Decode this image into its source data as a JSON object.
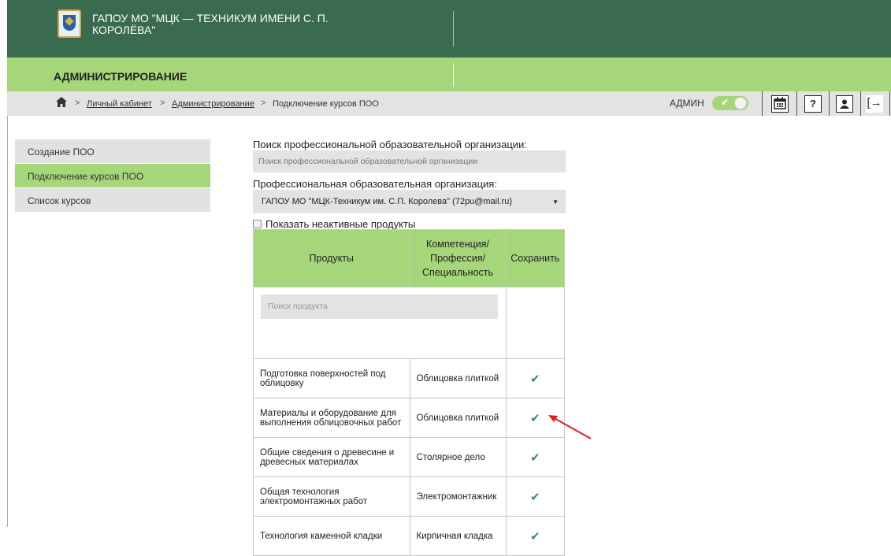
{
  "header": {
    "org_title": "ГАПОУ МО \"МЦК — ТЕХНИКУМ ИМЕНИ С. П. КОРОЛЁВА\"",
    "section_title": "АДМИНИСТРИРОВАНИЕ"
  },
  "breadcrumb": {
    "items": [
      "Личный кабинет",
      "Администрирование",
      "Подключение курсов ПОО"
    ],
    "separator": ">"
  },
  "toolbar": {
    "role_label": "АДМИН",
    "help_label": "?",
    "logout_label": "[→"
  },
  "sidebar": {
    "items": [
      {
        "label": "Создание ПОО",
        "active": false
      },
      {
        "label": "Подключение курсов ПОО",
        "active": true
      },
      {
        "label": "Список курсов",
        "active": false
      }
    ]
  },
  "main": {
    "search_label": "Поиск профессиональной образовательной организации:",
    "search_placeholder": "Поиск профессиональной образовательной организации",
    "org_label": "Профессиональная образовательная организация:",
    "org_selected": "ГАПОУ МО \"МЦК-Техникум им. С.П. Королева\" (72pu@mail.ru)",
    "show_inactive_label": "Показать неактивные продукты",
    "table": {
      "columns": [
        "Продукты",
        "Компетенция/ Профессия/ Специальность",
        "Сохранить"
      ],
      "product_search_placeholder": "Поиск продукта",
      "rows": [
        {
          "product": "Подготовка поверхностей под облицовку",
          "competence": "Облицовка плиткой",
          "saved": "✔"
        },
        {
          "product": "Материалы и оборудование для выполнения облицовочных работ",
          "competence": "Облицовка плиткой",
          "saved": "✔"
        },
        {
          "product": "Общие сведения о древесине и древесных материалах",
          "competence": "Столярное дело",
          "saved": "✔"
        },
        {
          "product": "Общая технология электромонтажных работ",
          "competence": "Электромонтажник",
          "saved": "✔"
        },
        {
          "product": "Технология каменной кладки",
          "competence": "Кирпичная кладка",
          "saved": "✔"
        }
      ]
    }
  },
  "colors": {
    "header_green": "#3a6b4f",
    "accent_green": "#a6d67a",
    "check_green": "#3e8e5a",
    "annotation_red": "#e02020"
  },
  "icons": [
    "home-icon",
    "calendar-icon",
    "help-icon",
    "profile-icon",
    "logout-icon",
    "checkmark-icon",
    "dropdown-arrow-icon"
  ]
}
